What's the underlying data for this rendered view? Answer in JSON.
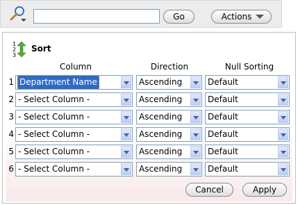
{
  "toolbar": {
    "search_value": "",
    "go_label": "Go",
    "actions_label": "Actions"
  },
  "sort": {
    "title": "Sort",
    "headers": {
      "column": "Column",
      "direction": "Direction",
      "null_sorting": "Null Sorting"
    },
    "rows": [
      {
        "num": "1",
        "column": "Department Name",
        "direction": "Ascending",
        "nulls": "Default"
      },
      {
        "num": "2",
        "column": "- Select Column -",
        "direction": "Ascending",
        "nulls": "Default"
      },
      {
        "num": "3",
        "column": "- Select Column -",
        "direction": "Ascending",
        "nulls": "Default"
      },
      {
        "num": "4",
        "column": "- Select Column -",
        "direction": "Ascending",
        "nulls": "Default"
      },
      {
        "num": "5",
        "column": "- Select Column -",
        "direction": "Ascending",
        "nulls": "Default"
      },
      {
        "num": "6",
        "column": "- Select Column -",
        "direction": "Ascending",
        "nulls": "Default"
      }
    ],
    "cancel_label": "Cancel",
    "apply_label": "Apply"
  }
}
